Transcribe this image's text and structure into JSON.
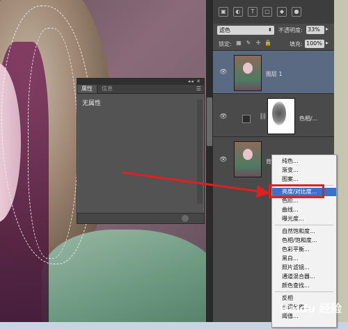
{
  "blend_mode": "滤色",
  "opacity_label": "不透明度:",
  "opacity_value": "33%",
  "lock_label": "锁定:",
  "fill_label": "填充:",
  "fill_value": "100%",
  "properties_panel": {
    "tab_properties": "属性",
    "tab_info": "信息",
    "content": "无属性"
  },
  "layers": [
    {
      "name": "图层 1",
      "selected": true
    },
    {
      "name": "色相/...",
      "selected": false
    },
    {
      "name": "背",
      "selected": false
    }
  ],
  "menu_items": [
    "纯色...",
    "渐变...",
    "图案...",
    "亮度/对比度...",
    "色阶...",
    "曲线...",
    "曝光度...",
    "自然饱和度...",
    "色相/饱和度...",
    "色彩平衡...",
    "黑白...",
    "照片滤镜...",
    "通道混合器...",
    "颜色查找...",
    "反相",
    "色调分离...",
    "阈值..."
  ],
  "highlighted_item_index": 3,
  "watermark": "Baidu 经验",
  "colors": {
    "accent_red": "#e02020",
    "menu_highlight": "#3a72c8",
    "selected_layer": "#5a6a82"
  }
}
